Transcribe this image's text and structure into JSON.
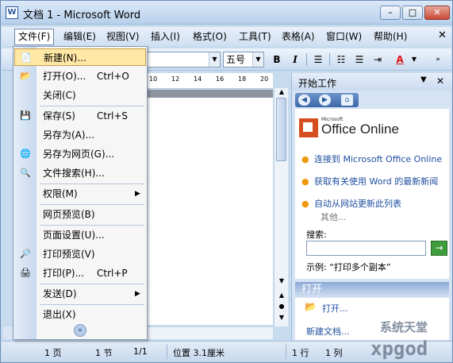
{
  "window": {
    "app_icon": "W",
    "title": "文档 1 - Microsoft Word",
    "min": "–",
    "max": "□",
    "close": "✕"
  },
  "menubar": {
    "items": [
      "文件(F)",
      "编辑(E)",
      "视图(V)",
      "插入(I)",
      "格式(O)",
      "工具(T)",
      "表格(A)",
      "窗口(W)",
      "帮助(H)"
    ],
    "close": "✕"
  },
  "toolbar": {
    "font_value": "",
    "size_value": "五号",
    "bold": "B",
    "italic": "I",
    "font_color": "A"
  },
  "ruler": {
    "numbers": [
      "10",
      "12",
      "14",
      "16",
      "18",
      "20"
    ]
  },
  "file_menu": {
    "items": [
      {
        "label": "新建(N)...",
        "shortcut": "",
        "icon": "📄"
      },
      {
        "label": "打开(O)...",
        "shortcut": "Ctrl+O",
        "icon": "📂"
      },
      {
        "label": "关闭(C)",
        "shortcut": "",
        "icon": ""
      },
      {
        "label": "保存(S)",
        "shortcut": "Ctrl+S",
        "icon": "💾"
      },
      {
        "label": "另存为(A)...",
        "shortcut": "",
        "icon": ""
      },
      {
        "label": "另存为网页(G)...",
        "shortcut": "",
        "icon": "🌐"
      },
      {
        "label": "文件搜索(H)...",
        "shortcut": "",
        "icon": "🔍"
      },
      {
        "label": "权限(M)",
        "shortcut": "",
        "icon": ""
      },
      {
        "label": "网页预览(B)",
        "shortcut": "",
        "icon": ""
      },
      {
        "label": "页面设置(U)...",
        "shortcut": "",
        "icon": ""
      },
      {
        "label": "打印预览(V)",
        "shortcut": "",
        "icon": "🔎"
      },
      {
        "label": "打印(P)...",
        "shortcut": "Ctrl+P",
        "icon": "🖨"
      },
      {
        "label": "发送(D)",
        "shortcut": "",
        "icon": ""
      },
      {
        "label": "退出(X)",
        "shortcut": "",
        "icon": ""
      }
    ],
    "more": "»"
  },
  "taskpane": {
    "title": "开始工作",
    "drop": "▼",
    "close": "✕",
    "logo_small": "Microsoft",
    "logo_text": "Office Online",
    "links": [
      "连接到 Microsoft Office Online",
      "获取有关使用 Word 的最新新闻",
      "自动从网站更新此列表"
    ],
    "other": "其他...",
    "search_label": "搜索:",
    "search_go": "→",
    "example": "示例: “打印多个副本”",
    "open_header": "打开",
    "open_link": "打开...",
    "new_link": "新建文档..."
  },
  "statusbar": {
    "page": "1 页",
    "section": "1 节",
    "pages": "1/1",
    "position": "位置 3.1厘米",
    "line": "1 行",
    "col": "1 列"
  },
  "watermark": {
    "top": "系统天堂",
    "bottom": "xpgod"
  }
}
